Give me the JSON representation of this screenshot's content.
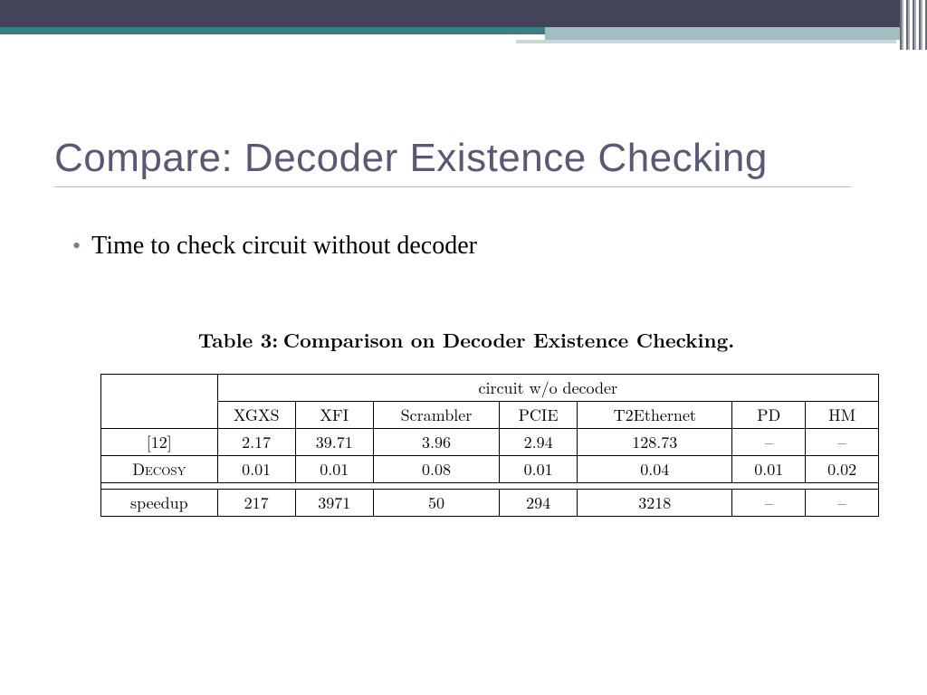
{
  "title": "Compare: Decoder Existence Checking",
  "bullet": "Time to check circuit without decoder",
  "caption_prefix": "Table 3:",
  "caption_text": "Comparison on Decoder Existence Checking.",
  "header_span": "circuit w/o decoder",
  "columns": {
    "c1": "XGXS",
    "c2": "XFI",
    "c3": "Scrambler",
    "c4": "PCIE",
    "c5": "T2Ethernet",
    "c6": "PD",
    "c7": "HM"
  },
  "rows": {
    "r1": {
      "label": "[12]",
      "v1": "2.17",
      "v2": "39.71",
      "v3": "3.96",
      "v4": "2.94",
      "v5": "128.73",
      "v6": "–",
      "v7": "–"
    },
    "r2": {
      "label": "Decosy",
      "v1": "0.01",
      "v2": "0.01",
      "v3": "0.08",
      "v4": "0.01",
      "v5": "0.04",
      "v6": "0.01",
      "v7": "0.02"
    },
    "r3": {
      "label": "speedup",
      "v1": "217",
      "v2": "3971",
      "v3": "50",
      "v4": "294",
      "v5": "3218",
      "v6": "–",
      "v7": "–"
    }
  },
  "chart_data": {
    "type": "table",
    "title": "Comparison on Decoder Existence Checking.",
    "xlabel": "circuit w/o decoder",
    "columns": [
      "XGXS",
      "XFI",
      "Scrambler",
      "PCIE",
      "T2Ethernet",
      "PD",
      "HM"
    ],
    "series": [
      {
        "name": "[12]",
        "values": [
          2.17,
          39.71,
          3.96,
          2.94,
          128.73,
          null,
          null
        ]
      },
      {
        "name": "Decosy",
        "values": [
          0.01,
          0.01,
          0.08,
          0.01,
          0.04,
          0.01,
          0.02
        ]
      },
      {
        "name": "speedup",
        "values": [
          217,
          3971,
          50,
          294,
          3218,
          null,
          null
        ]
      }
    ]
  }
}
